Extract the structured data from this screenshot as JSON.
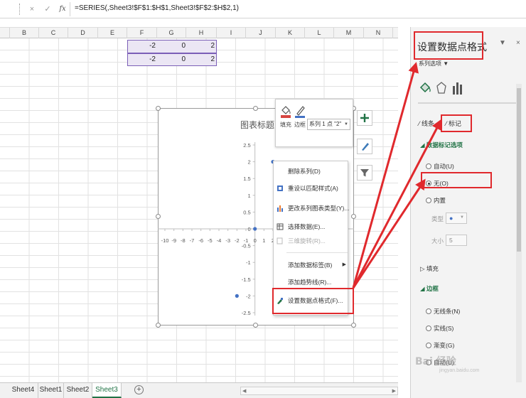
{
  "formula_bar": {
    "cancel_icon": "×",
    "enter_icon": "✓",
    "fx_label": "fx",
    "formula": "=SERIES(,Sheet3!$F$1:$H$1,Sheet3!$F$2:$H$2,1)"
  },
  "columns": [
    "B",
    "C",
    "D",
    "E",
    "F",
    "G",
    "H",
    "I",
    "J",
    "K",
    "L",
    "M",
    "N"
  ],
  "cells": {
    "row1": [
      "-2",
      "0",
      "2"
    ],
    "row2": [
      "-2",
      "0",
      "2"
    ]
  },
  "sheet_tabs": [
    "Sheet4",
    "Sheet1",
    "Sheet2",
    "Sheet3"
  ],
  "active_sheet": "Sheet3",
  "add_sheet": "+",
  "chart": {
    "title": "图表标题",
    "chart_data": {
      "type": "scatter",
      "title": "图表标题",
      "x_ticks": [
        "-10",
        "-9",
        "-8",
        "-7",
        "-6",
        "-5",
        "-4",
        "-3",
        "-2",
        "-1",
        "0",
        "1",
        "2"
      ],
      "y_ticks": [
        "2.5",
        "2",
        "1.5",
        "1",
        "0.5",
        "0",
        "-0.5",
        "-1",
        "-1.5",
        "-2",
        "-2.5"
      ],
      "xlim": [
        -10,
        2
      ],
      "ylim": [
        -2.5,
        2.5
      ],
      "points": [
        {
          "x": -2,
          "y": -2
        },
        {
          "x": 0,
          "y": 0
        },
        {
          "x": 2,
          "y": 2
        }
      ],
      "grid": false
    }
  },
  "mini_toolbar": {
    "fill_label": "填充",
    "border_label": "边框",
    "series_select": "系列 1 点 \"2\""
  },
  "context_menu": [
    {
      "label": "删除系列(D)",
      "disabled": false
    },
    {
      "label": "重设以匹配样式(A)",
      "disabled": false
    },
    {
      "label": "更改系列图表类型(Y)...",
      "disabled": false
    },
    {
      "label": "选择数据(E)...",
      "disabled": false
    },
    {
      "label": "三维旋转(R)...",
      "disabled": true
    },
    {
      "label": "添加数据标签(B)",
      "disabled": false
    },
    {
      "label": "添加趋势线(R)...",
      "disabled": false
    },
    {
      "label": "设置数据点格式(F)...",
      "disabled": false
    }
  ],
  "pane": {
    "title": "设置数据点格式",
    "subtitle": "系列选项 ▼",
    "tab_line": "线条",
    "tab_marker": "标记",
    "section_marker_options": "数据标记选项",
    "opt_auto": "自动(U)",
    "opt_none": "无(O)",
    "opt_builtin": "内置",
    "label_type": "类型",
    "label_size": "大小",
    "size_value": "5",
    "section_fill": "填充",
    "section_border": "边框",
    "opt_no_line": "无线条(N)",
    "opt_solid": "实线(S)",
    "opt_gradient": "渐变(G)",
    "opt_auto2": "自动(U)",
    "close": "×",
    "pin": "▼"
  },
  "watermark": "Bai 经验",
  "watermark_sub": "jingyan.baidu.com",
  "colors": {
    "accent": "#217346",
    "annotation_red": "#e0292d",
    "marker": "#4472c4",
    "selection_border": "#7b5fb7"
  }
}
